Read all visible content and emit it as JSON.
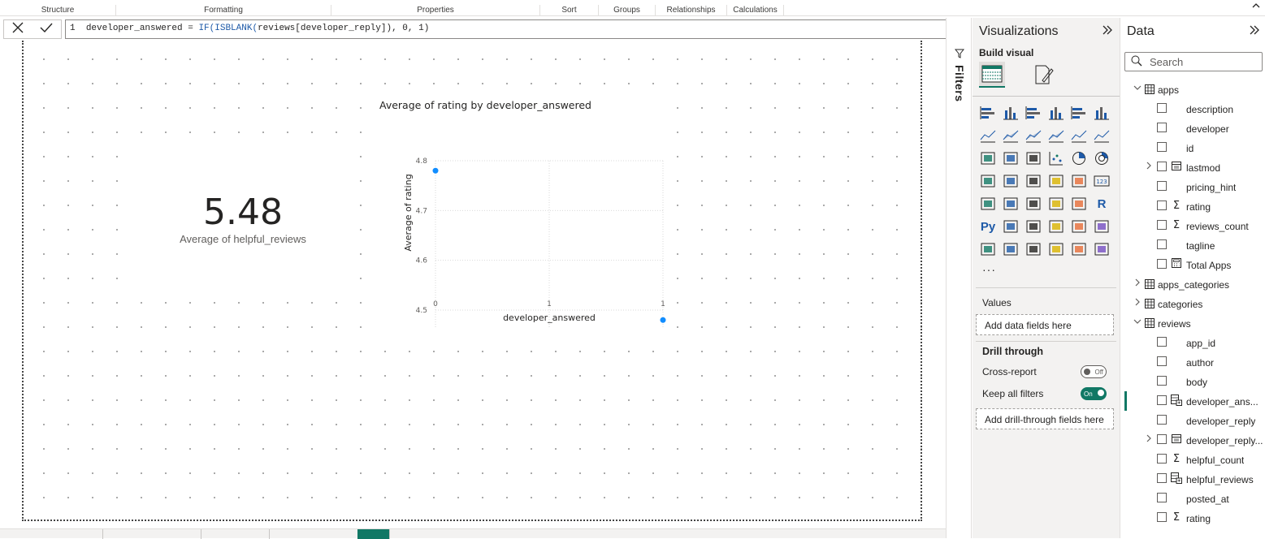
{
  "ribbon": {
    "groups": [
      "Structure",
      "Formatting",
      "Properties",
      "Sort",
      "Groups",
      "Relationships",
      "Calculations"
    ]
  },
  "formula": {
    "line_no": "1",
    "prefix": "developer_answered = ",
    "func1": "IF(ISBLANK(",
    "mid": "reviews[developer_reply]",
    "func2": "), 0, 1)"
  },
  "card": {
    "value": "5.48",
    "label": "Average of helpful_reviews"
  },
  "chart_data": {
    "type": "scatter",
    "title": "Average of rating by developer_answered",
    "xlabel": "developer_answered",
    "ylabel": "Average of rating",
    "x_ticks": [
      "0",
      "1",
      "1"
    ],
    "y_ticks": [
      "4.8",
      "4.7",
      "4.6",
      "4.5"
    ],
    "xlim": [
      0,
      1
    ],
    "ylim": [
      4.45,
      4.8
    ],
    "points": [
      {
        "x": 0,
        "y": 4.78
      },
      {
        "x": 1,
        "y": 4.48
      }
    ],
    "marker_color": "#118DFF",
    "grid": true
  },
  "filters": {
    "label": "Filters"
  },
  "viz": {
    "title": "Visualizations",
    "build_visual": "Build visual",
    "values_label": "Values",
    "values_placeholder": "Add data fields here",
    "drill_label": "Drill through",
    "cross_report": "Cross-report",
    "cross_report_state": "Off",
    "keep_filters": "Keep all filters",
    "keep_filters_state": "On",
    "drill_placeholder": "Add drill-through fields here",
    "more": "···"
  },
  "data_pane": {
    "title": "Data",
    "search_placeholder": "Search",
    "rows": [
      {
        "kind": "table",
        "label": "apps",
        "expanded": true
      },
      {
        "kind": "field",
        "label": "description",
        "icon": ""
      },
      {
        "kind": "field",
        "label": "developer",
        "icon": ""
      },
      {
        "kind": "field",
        "label": "id",
        "icon": ""
      },
      {
        "kind": "field",
        "label": "lastmod",
        "icon": "calendar",
        "expandable": true
      },
      {
        "kind": "field",
        "label": "pricing_hint",
        "icon": ""
      },
      {
        "kind": "field",
        "label": "rating",
        "icon": "sigma"
      },
      {
        "kind": "field",
        "label": "reviews_count",
        "icon": "sigma"
      },
      {
        "kind": "field",
        "label": "tagline",
        "icon": ""
      },
      {
        "kind": "field",
        "label": "Total Apps",
        "icon": "calculator"
      },
      {
        "kind": "table",
        "label": "apps_categories",
        "expanded": false
      },
      {
        "kind": "table",
        "label": "categories",
        "expanded": false
      },
      {
        "kind": "table",
        "label": "reviews",
        "expanded": true
      },
      {
        "kind": "field",
        "label": "app_id",
        "icon": ""
      },
      {
        "kind": "field",
        "label": "author",
        "icon": ""
      },
      {
        "kind": "field",
        "label": "body",
        "icon": ""
      },
      {
        "kind": "field",
        "label": "developer_ans...",
        "icon": "calc-column",
        "selected": true
      },
      {
        "kind": "field",
        "label": "developer_reply",
        "icon": ""
      },
      {
        "kind": "field",
        "label": "developer_reply...",
        "icon": "calendar",
        "expandable": true
      },
      {
        "kind": "field",
        "label": "helpful_count",
        "icon": "sigma"
      },
      {
        "kind": "field",
        "label": "helpful_reviews",
        "icon": "calc-column"
      },
      {
        "kind": "field",
        "label": "posted_at",
        "icon": ""
      },
      {
        "kind": "field",
        "label": "rating",
        "icon": "sigma"
      }
    ]
  },
  "colors": {
    "accent": "#117865",
    "chart_marker": "#118DFF",
    "pane_bg": "#F3F2F1"
  }
}
